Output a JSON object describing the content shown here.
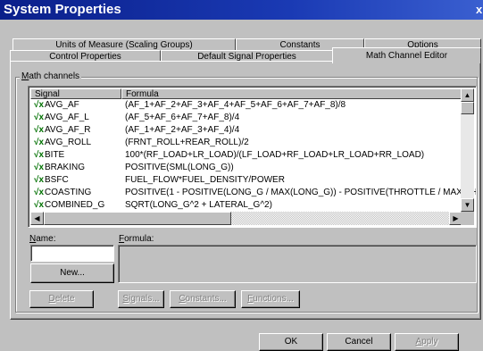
{
  "window": {
    "title": "System Properties",
    "close_glyph": "x"
  },
  "tabs_row1": [
    {
      "label": "Units of Measure (Scaling Groups)"
    },
    {
      "label": "Constants"
    },
    {
      "label": "Options"
    }
  ],
  "tabs_row2": [
    {
      "label": "Control Properties"
    },
    {
      "label": "Default Signal Properties"
    },
    {
      "label": "Math Channel Editor"
    }
  ],
  "group": {
    "label_access": "M",
    "label_rest": "ath channels"
  },
  "list": {
    "columns": [
      "Signal",
      "Formula"
    ],
    "icon": "math-channel-icon",
    "icon_glyph": "√x",
    "rows": [
      {
        "signal": "AVG_AF",
        "formula": "(AF_1+AF_2+AF_3+AF_4+AF_5+AF_6+AF_7+AF_8)/8"
      },
      {
        "signal": "AVG_AF_L",
        "formula": "(AF_5+AF_6+AF_7+AF_8)/4"
      },
      {
        "signal": "AVG_AF_R",
        "formula": "(AF_1+AF_2+AF_3+AF_4)/4"
      },
      {
        "signal": "AVG_ROLL",
        "formula": "(FRNT_ROLL+REAR_ROLL)/2"
      },
      {
        "signal": "BITE",
        "formula": "100*(RF_LOAD+LR_LOAD)/(LF_LOAD+RF_LOAD+LR_LOAD+RR_LOAD)"
      },
      {
        "signal": "BRAKING",
        "formula": "POSITIVE(SML(LONG_G))"
      },
      {
        "signal": "BSFC",
        "formula": "FUEL_FLOW*FUEL_DENSITY/POWER"
      },
      {
        "signal": "COASTING",
        "formula": "POSITIVE(1 - POSITIVE(LONG_G / MAX(LONG_G)) - POSITIVE(THROTTLE / MAX(THRO"
      },
      {
        "signal": "COMBINED_G",
        "formula": "SQRT(LONG_G^2 + LATERAL_G^2)"
      }
    ]
  },
  "name_label": {
    "access": "N",
    "rest": "ame:"
  },
  "formula_label": {
    "access": "F",
    "rest": "ormula:"
  },
  "name_value": "",
  "formula_value": "",
  "buttons": {
    "new": "New...",
    "delete_access": "D",
    "delete_rest": "elete",
    "signals_access": "S",
    "signals_rest": "ignals...",
    "constants_access": "C",
    "constants_rest": "onstants...",
    "functions_access": "F",
    "functions_rest": "unctions...",
    "ok": "OK",
    "cancel": "Cancel",
    "apply_access": "A",
    "apply_rest": "pply"
  }
}
